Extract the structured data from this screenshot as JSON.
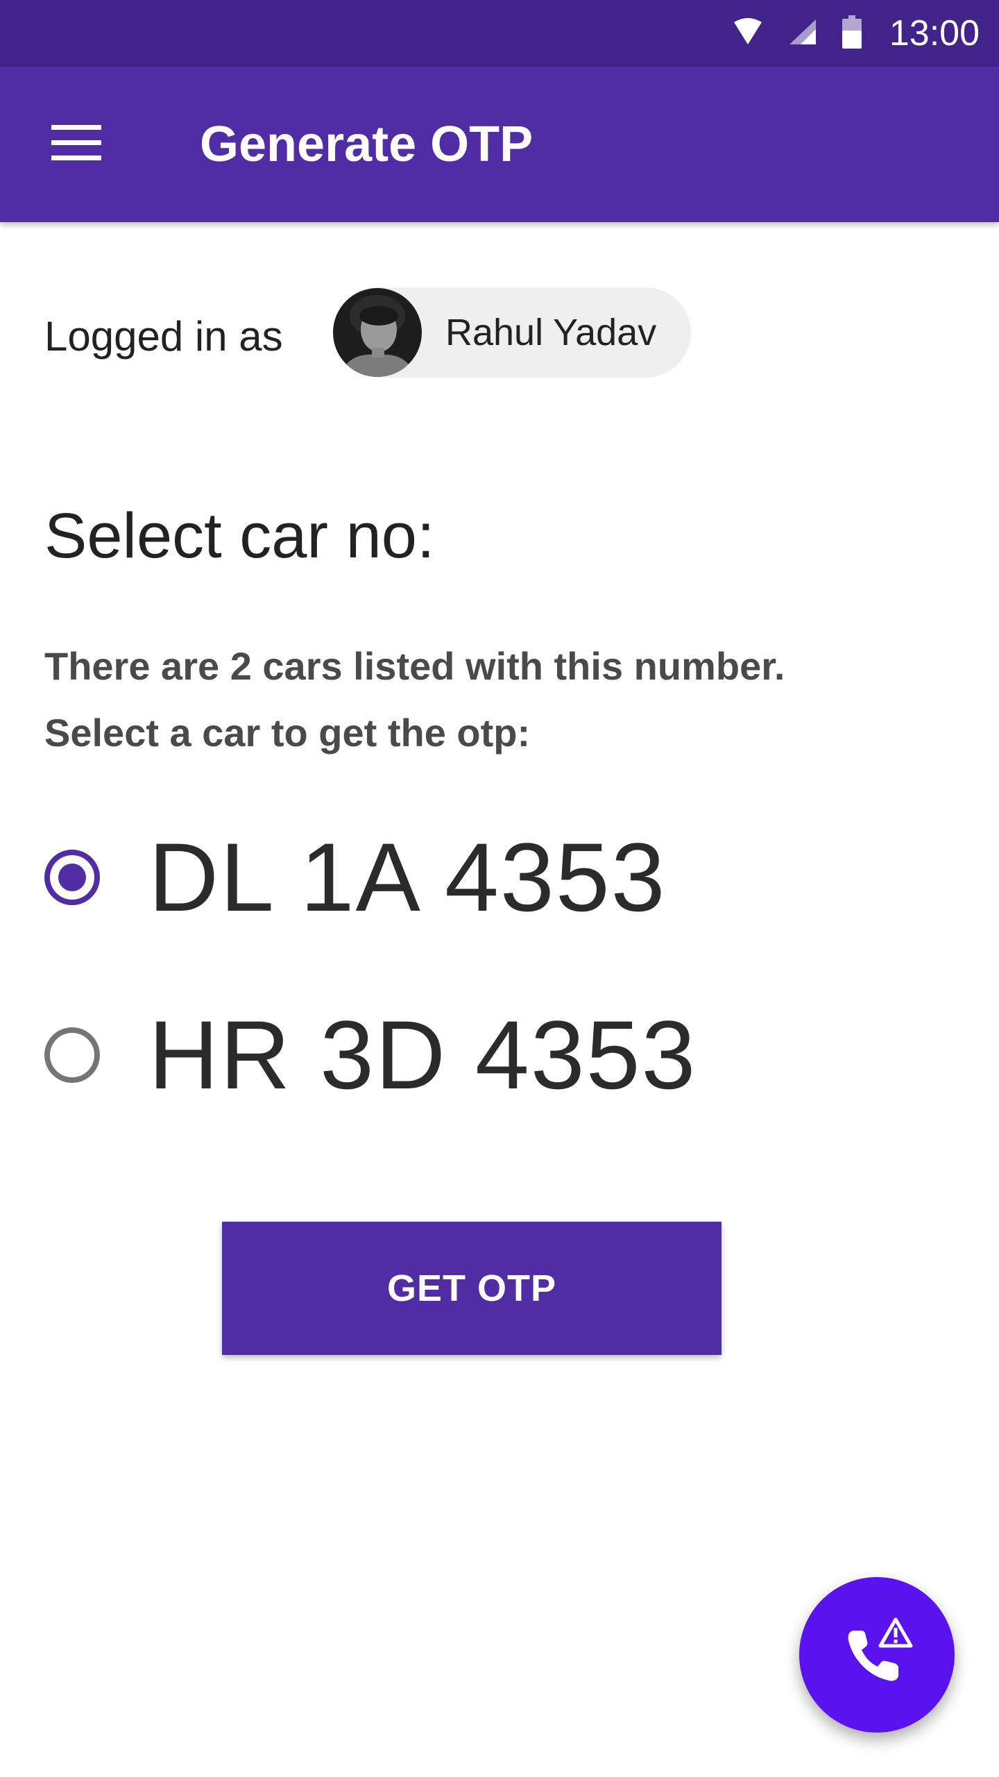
{
  "status_bar": {
    "time": "13:00",
    "icons": [
      "wifi-icon",
      "signal-icon",
      "battery-icon"
    ]
  },
  "app_bar": {
    "title": "Generate OTP",
    "menu_icon": "hamburger-menu-icon"
  },
  "user": {
    "logged_in_label": "Logged in as",
    "name": "Rahul Yadav"
  },
  "car_selection": {
    "title": "Select car no:",
    "description_line1": "There are 2 cars listed with this number.",
    "description_line2": "Select a car to get the otp:",
    "options": [
      {
        "label": "DL 1A 4353",
        "selected": true
      },
      {
        "label": "HR 3D 4353",
        "selected": false
      }
    ]
  },
  "actions": {
    "get_otp_label": "GET OTP",
    "fab_icon": "phone-alert-icon"
  },
  "colors": {
    "status_bar": "#42238a",
    "primary": "#502da5",
    "fab": "#5a12ef",
    "text": "#222222"
  }
}
